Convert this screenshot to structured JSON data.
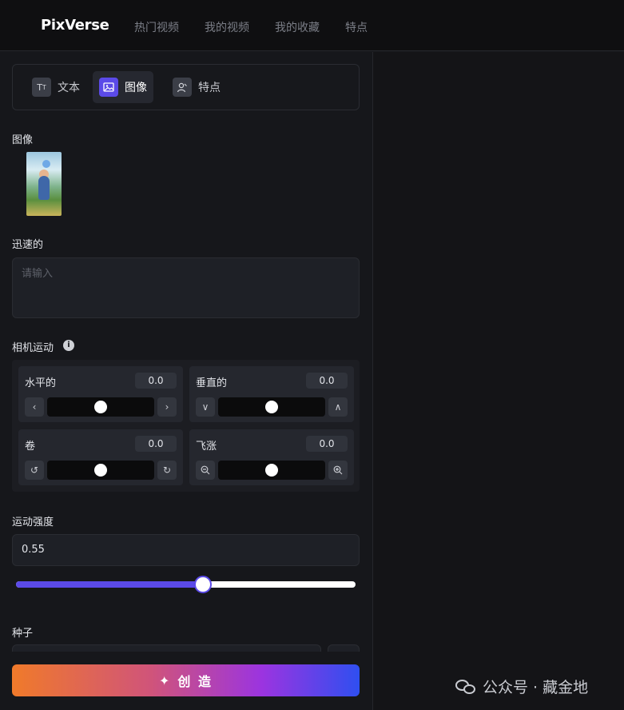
{
  "app": {
    "logo": "PixVerse"
  },
  "nav": [
    {
      "label": "热门视频"
    },
    {
      "label": "我的视频"
    },
    {
      "label": "我的收藏"
    },
    {
      "label": "特点"
    }
  ],
  "modes": [
    {
      "label": "文本",
      "icon": "text-icon",
      "active": false
    },
    {
      "label": "图像",
      "icon": "image-icon",
      "active": true
    },
    {
      "label": "特点",
      "icon": "character-icon",
      "active": false
    }
  ],
  "image_section": {
    "label": "图像"
  },
  "prompt": {
    "label": "迅速的",
    "placeholder": "请输入"
  },
  "camera": {
    "label": "相机运动",
    "info_icon": "info-icon",
    "controls": [
      {
        "name": "水平的",
        "value": "0.0",
        "minus_icon": "chevron-left-icon",
        "plus_icon": "chevron-right-icon"
      },
      {
        "name": "垂直的",
        "value": "0.0",
        "minus_icon": "chevron-down-icon",
        "plus_icon": "chevron-up-icon"
      },
      {
        "name": "卷",
        "value": "0.0",
        "minus_icon": "rotate-left-icon",
        "plus_icon": "rotate-right-icon"
      },
      {
        "name": "飞涨",
        "value": "0.0",
        "minus_icon": "zoom-out-icon",
        "plus_icon": "zoom-in-icon"
      }
    ]
  },
  "motion_strength": {
    "label": "运动强度",
    "value": "0.55",
    "fraction": 0.55
  },
  "seed": {
    "label": "种子"
  },
  "create_button": {
    "label": "创 造",
    "icon": "sparkle-icon"
  },
  "watermark": {
    "text": "公众号 · 藏金地"
  },
  "colors": {
    "accent": "#5b4ae8",
    "background": "#16171b"
  }
}
